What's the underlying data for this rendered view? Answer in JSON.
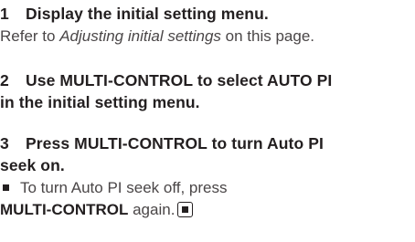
{
  "steps": [
    {
      "number": "1",
      "title": "Display the initial setting menu.",
      "body_prefix": "Refer to ",
      "body_italic": "Adjusting initial settings",
      "body_suffix": " on this page."
    },
    {
      "number": "2",
      "title_line1": "Use MULTI-CONTROL to select AUTO PI",
      "title_line2": "in the initial setting menu."
    },
    {
      "number": "3",
      "title_line1": "Press MULTI-CONTROL to turn Auto PI",
      "title_line2": "seek on.",
      "note_line1": "To turn Auto PI seek off, press",
      "note_bold": "MULTI-CONTROL",
      "note_suffix": " again."
    }
  ],
  "icons": {
    "bullet": "square-bullet-icon",
    "end": "end-of-section-icon"
  }
}
